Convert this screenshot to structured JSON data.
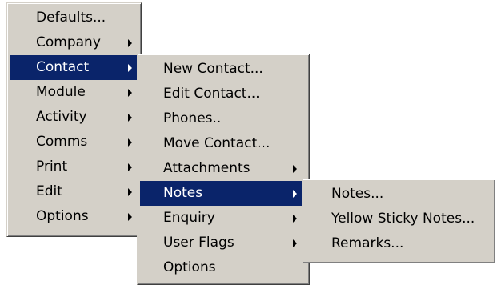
{
  "menu_main": {
    "items": [
      {
        "label": "Defaults..."
      },
      {
        "label": "Company"
      },
      {
        "label": "Contact"
      },
      {
        "label": "Module"
      },
      {
        "label": "Activity"
      },
      {
        "label": "Comms"
      },
      {
        "label": "Print"
      },
      {
        "label": "Edit"
      },
      {
        "label": "Options"
      }
    ]
  },
  "menu_contact": {
    "items": [
      {
        "label": "New Contact..."
      },
      {
        "label": "Edit Contact..."
      },
      {
        "label": "Phones.."
      },
      {
        "label": "Move Contact..."
      },
      {
        "label": "Attachments"
      },
      {
        "label": "Notes"
      },
      {
        "label": "Enquiry"
      },
      {
        "label": "User Flags"
      },
      {
        "label": "Options"
      }
    ]
  },
  "menu_notes": {
    "items": [
      {
        "label": "Notes..."
      },
      {
        "label": "Yellow Sticky Notes..."
      },
      {
        "label": "Remarks..."
      }
    ]
  },
  "colors": {
    "menu_bg": "#d4d0c8",
    "highlight_bg": "#0a246a",
    "highlight_text": "#ffffff"
  }
}
